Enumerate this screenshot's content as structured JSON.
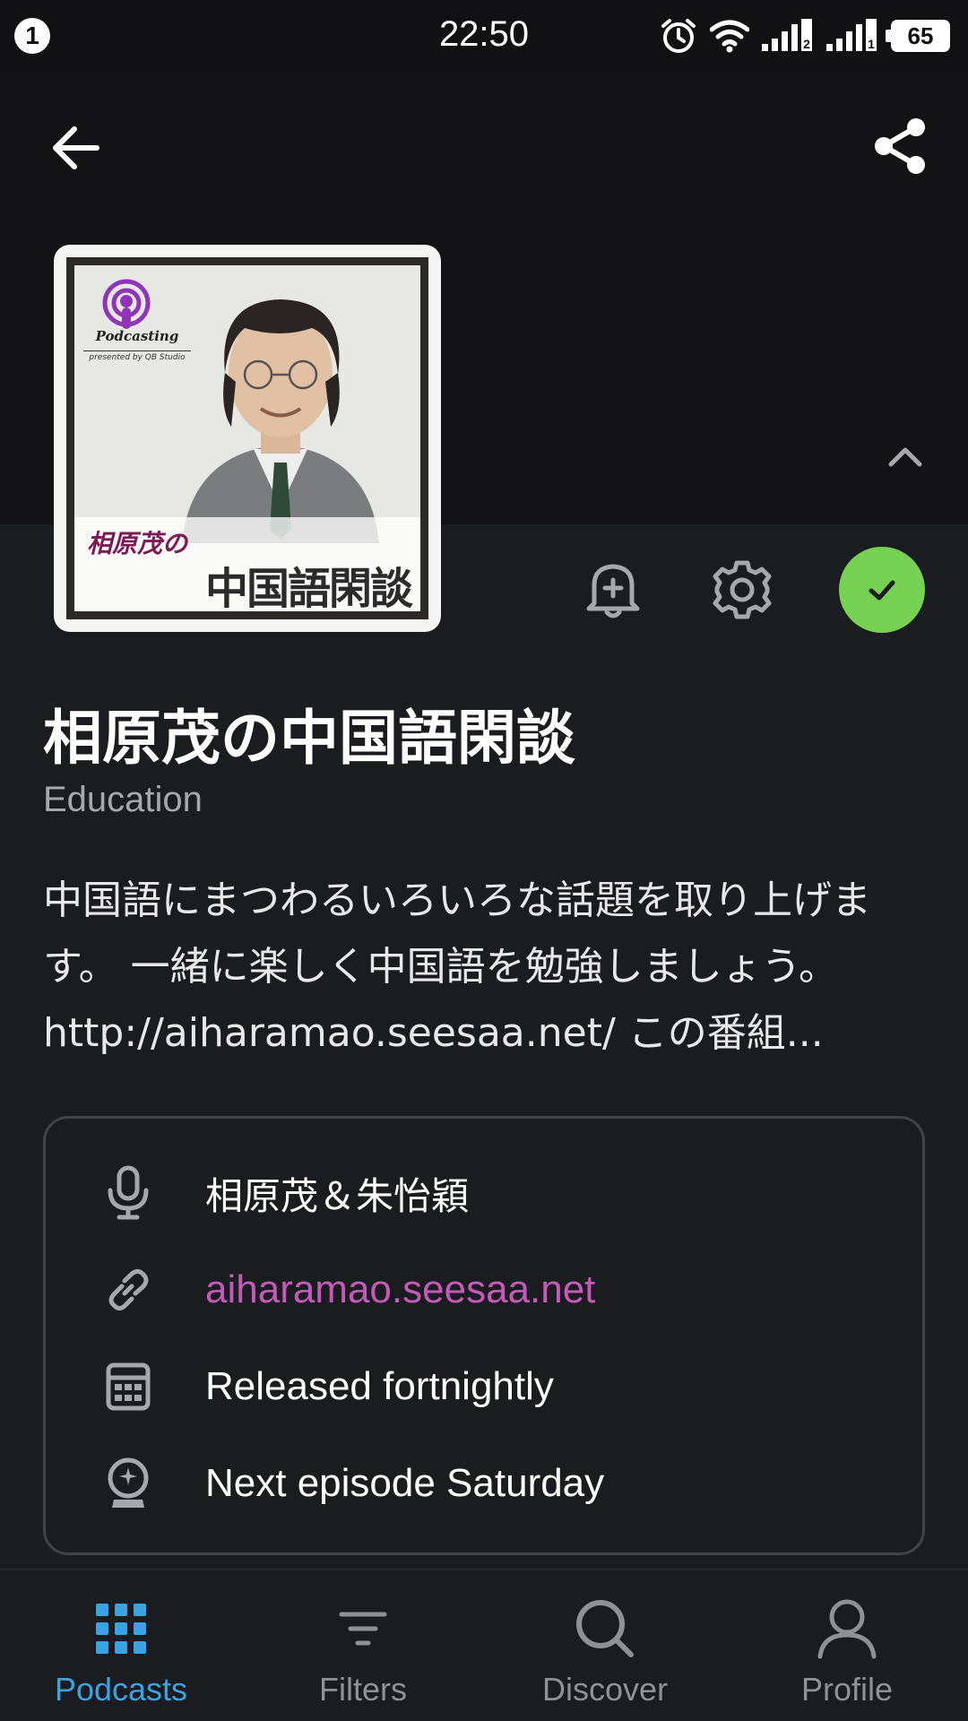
{
  "status_bar": {
    "notification_count": "1",
    "time": "22:50",
    "battery": "65",
    "icons": [
      "alarm-icon",
      "wifi-icon",
      "signal-sim2-icon",
      "signal-sim1-icon",
      "battery-icon"
    ]
  },
  "header": {
    "back_icon": "arrow-left-icon",
    "share_icon": "share-icon",
    "collapse_icon": "chevron-up-icon"
  },
  "artwork": {
    "badge_text": "Podcasting",
    "presented_by": "presented by QB Studio",
    "title_small": "相原茂の",
    "title_big": "中国語閑談"
  },
  "actions": {
    "notify_icon": "bell-plus-icon",
    "settings_icon": "gear-icon",
    "subscribed_icon": "check-icon",
    "subscribed_color": "#77d254"
  },
  "podcast": {
    "title": "相原茂の中国語閑談",
    "category": "Education",
    "description": "中国語にまつわるいろいろな話題を取り上げます。 一緒に楽しく中国語を勉強しましょう。 http://aiharamao.seesaa.net/  この番組..."
  },
  "info": {
    "author": "相原茂＆朱怡穎",
    "website": "aiharamao.seesaa.net",
    "frequency": "Released fortnightly",
    "next_episode": "Next episode Saturday",
    "link_color": "#c45ab8"
  },
  "nav": {
    "active_color": "#3aa3e3",
    "tabs": [
      {
        "label": "Podcasts",
        "icon": "grid-icon",
        "active": true
      },
      {
        "label": "Filters",
        "icon": "filter-icon",
        "active": false
      },
      {
        "label": "Discover",
        "icon": "search-icon",
        "active": false
      },
      {
        "label": "Profile",
        "icon": "person-icon",
        "active": false
      }
    ]
  }
}
